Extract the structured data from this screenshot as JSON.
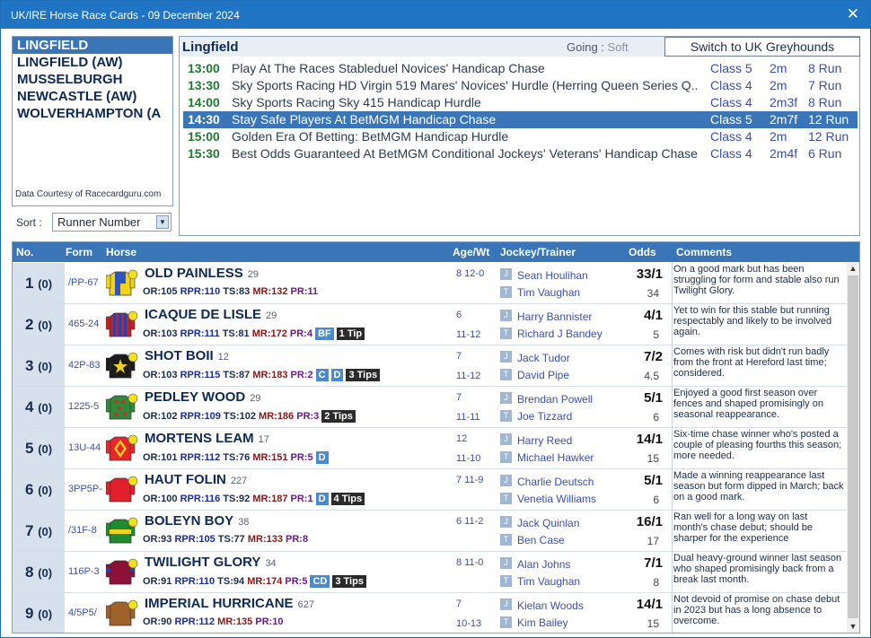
{
  "window": {
    "title": "UK/IRE Horse Race Cards - 09 December 2024",
    "close_glyph": "✕"
  },
  "venues": {
    "items": [
      "LINGFIELD",
      "LINGFIELD (AW)",
      "MUSSELBURGH",
      "NEWCASTLE (AW)",
      "WOLVERHAMPTON (A"
    ],
    "selected": "LINGFIELD",
    "courtesy": "Data Courtesy of Racecardguru.com"
  },
  "sort": {
    "label": "Sort :",
    "value": "Runner Number"
  },
  "races_panel": {
    "course": "Lingfield",
    "going_label": "Going :",
    "going_value": "Soft",
    "switch_label": "Switch to UK Greyhounds",
    "races": [
      {
        "time": "13:00",
        "name": "Play At The Races Stableduel Novices' Handicap Chase",
        "class": "Class 5",
        "dist": "2m",
        "runners": "8 Run"
      },
      {
        "time": "13:30",
        "name": "Sky Sports Racing HD Virgin 519 Mares' Novices' Hurdle (Herring Queen Series Q...",
        "class": "Class 4",
        "dist": "2m",
        "runners": "7 Run"
      },
      {
        "time": "14:00",
        "name": "Sky Sports Racing Sky 415 Handicap Hurdle",
        "class": "Class 4",
        "dist": "2m3f",
        "runners": "8 Run"
      },
      {
        "time": "14:30",
        "name": "Stay Safe Players At BetMGM Handicap Chase",
        "class": "Class 5",
        "dist": "2m7f",
        "runners": "12 Run",
        "selected": true
      },
      {
        "time": "15:00",
        "name": "Golden Era Of Betting: BetMGM Handicap Hurdle",
        "class": "Class 4",
        "dist": "2m",
        "runners": "12 Run"
      },
      {
        "time": "15:30",
        "name": "Best Odds Guaranteed At BetMGM Conditional Jockeys' Veterans' Handicap Chase",
        "class": "Class 4",
        "dist": "2m4f",
        "runners": "6 Run"
      }
    ]
  },
  "table": {
    "headers": {
      "no": "No.",
      "form": "Form",
      "horse": "Horse",
      "agewt": "Age/Wt",
      "jockey_trainer": "Jockey/Trainer",
      "odds": "Odds",
      "comments": "Comments"
    },
    "badge_j": "J",
    "badge_t": "T",
    "runners": [
      {
        "no": "1",
        "draw": "(0)",
        "form": "/PP-67",
        "name": "OLD PAINLESS",
        "rank": "29",
        "or": "OR:105",
        "rpr": "RPR:110",
        "ts": "TS:83",
        "mr": "MR:132",
        "pr": "PR:11",
        "tags": [],
        "age": "8  12-0",
        "wt": "",
        "jockey": "Sean Houlihan",
        "trainer": "Tim Vaughan",
        "odds": "33/1",
        "odds2": "34",
        "comment": "On a good mark but has been struggling for form and stable also run Twilight Glory.",
        "silk": "silk-blue-yellow"
      },
      {
        "no": "2",
        "draw": "(0)",
        "form": "465-24",
        "name": "ICAQUE DE LISLE",
        "rank": "29",
        "or": "OR:103",
        "rpr": "RPR:111",
        "ts": "TS:81",
        "mr": "MR:172",
        "pr": "PR:4",
        "tags": [
          {
            "t": "BF",
            "c": "blue"
          },
          {
            "t": "1 Tip",
            "c": "dark"
          }
        ],
        "age": "6",
        "wt": "11-12",
        "jockey": "Harry Bannister",
        "trainer": "Richard J Bandey",
        "odds": "4/1",
        "odds2": "5",
        "comment": "Yet to win for this stable but running respectably and likely to be involved again.",
        "silk": "silk-red-blue-stripes"
      },
      {
        "no": "3",
        "draw": "(0)",
        "form": "42P-83",
        "name": "SHOT BOII",
        "rank": "12",
        "or": "OR:103",
        "rpr": "RPR:115",
        "ts": "TS:87",
        "mr": "MR:183",
        "pr": "PR:2",
        "tags": [
          {
            "t": "C",
            "c": "blue"
          },
          {
            "t": "D",
            "c": "blue"
          },
          {
            "t": "3 Tips",
            "c": "dark"
          }
        ],
        "age": "7",
        "wt": "11-12",
        "jockey": "Jack Tudor",
        "trainer": "David Pipe",
        "odds": "7/2",
        "odds2": "4.5",
        "comment": "Comes with risk but didn't run badly from the front at Hereford last time; considered.",
        "silk": "silk-black-star"
      },
      {
        "no": "4",
        "draw": "(0)",
        "form": "1225-5",
        "name": "PEDLEY WOOD",
        "rank": "29",
        "or": "OR:102",
        "rpr": "RPR:109",
        "ts": "TS:102",
        "mr": "MR:186",
        "pr": "PR:3",
        "tags": [
          {
            "t": "2 Tips",
            "c": "dark"
          }
        ],
        "age": "7",
        "wt": "11-11",
        "jockey": "Brendan Powell",
        "trainer": "Joe Tizzard",
        "odds": "5/1",
        "odds2": "6",
        "comment": "Enjoyed a good first season over fences and shaped promisingly on seasonal reappearance.",
        "silk": "silk-green-red-spots"
      },
      {
        "no": "5",
        "draw": "(0)",
        "form": "13U-44",
        "name": "MORTENS LEAM",
        "rank": "17",
        "or": "OR:101",
        "rpr": "RPR:112",
        "ts": "TS:76",
        "mr": "MR:151",
        "pr": "PR:5",
        "tags": [
          {
            "t": "D",
            "c": "blue"
          }
        ],
        "age": "12",
        "wt": "11-10",
        "jockey": "Harry Reed",
        "trainer": "Michael Hawker",
        "odds": "14/1",
        "odds2": "15",
        "comment": "Six-time chase winner who's posted a couple of pleasing fourths this season; more needed.",
        "silk": "silk-red-yellow-diamond"
      },
      {
        "no": "6",
        "draw": "(0)",
        "form": "3PP5P-",
        "name": "HAUT FOLIN",
        "rank": "227",
        "or": "OR:100",
        "rpr": "RPR:116",
        "ts": "TS:92",
        "mr": "MR:187",
        "pr": "PR:1",
        "tags": [
          {
            "t": "D",
            "c": "blue"
          },
          {
            "t": "4 Tips",
            "c": "dark"
          }
        ],
        "age": "7  11-9",
        "wt": "",
        "jockey": "Charlie Deutsch",
        "trainer": "Venetia Williams",
        "odds": "5/1",
        "odds2": "6",
        "comment": "Made a winning reappearance last season but form dipped in March; back on a good mark.",
        "silk": "silk-red"
      },
      {
        "no": "7",
        "draw": "(0)",
        "form": "/31F-8",
        "name": "BOLEYN BOY",
        "rank": "38",
        "or": "OR:93",
        "rpr": "RPR:105",
        "ts": "TS:77",
        "mr": "MR:133",
        "pr": "PR:8",
        "tags": [],
        "age": "6  11-2",
        "wt": "",
        "jockey": "Jack Quinlan",
        "trainer": "Ben Case",
        "odds": "16/1",
        "odds2": "17",
        "comment": "Ran well for a long way on last month's chase debut; should be sharper for the experience",
        "silk": "silk-green-yellow"
      },
      {
        "no": "8",
        "draw": "(0)",
        "form": "116P-3",
        "name": "TWILIGHT GLORY",
        "rank": "34",
        "or": "OR:91",
        "rpr": "RPR:110",
        "ts": "TS:94",
        "mr": "MR:174",
        "pr": "PR:5",
        "tags": [
          {
            "t": "CD",
            "c": "blue"
          },
          {
            "t": "3 Tips",
            "c": "dark"
          }
        ],
        "age": "8  11-0",
        "wt": "",
        "jockey": "Alan Johns",
        "trainer": "Tim Vaughan",
        "odds": "7/1",
        "odds2": "8",
        "comment": "Dual heavy-ground winner last season who shaped promisingly back from a break last month.",
        "silk": "silk-maroon"
      },
      {
        "no": "9",
        "draw": "(0)",
        "form": "4/5P5/",
        "name": "IMPERIAL HURRICANE",
        "rank": "627",
        "or": "OR:90",
        "rpr": "RPR:112",
        "ts": "",
        "mr": "MR:135",
        "pr": "PR:10",
        "tags": [],
        "age": "7",
        "wt": "10-13",
        "jockey": "Kielan Woods",
        "trainer": "Kim Bailey",
        "odds": "14/1",
        "odds2": "15",
        "comment": "Not devoid of promise on chase debut in 2023 but has a long absence to overcome.",
        "silk": "silk-brown"
      }
    ]
  }
}
